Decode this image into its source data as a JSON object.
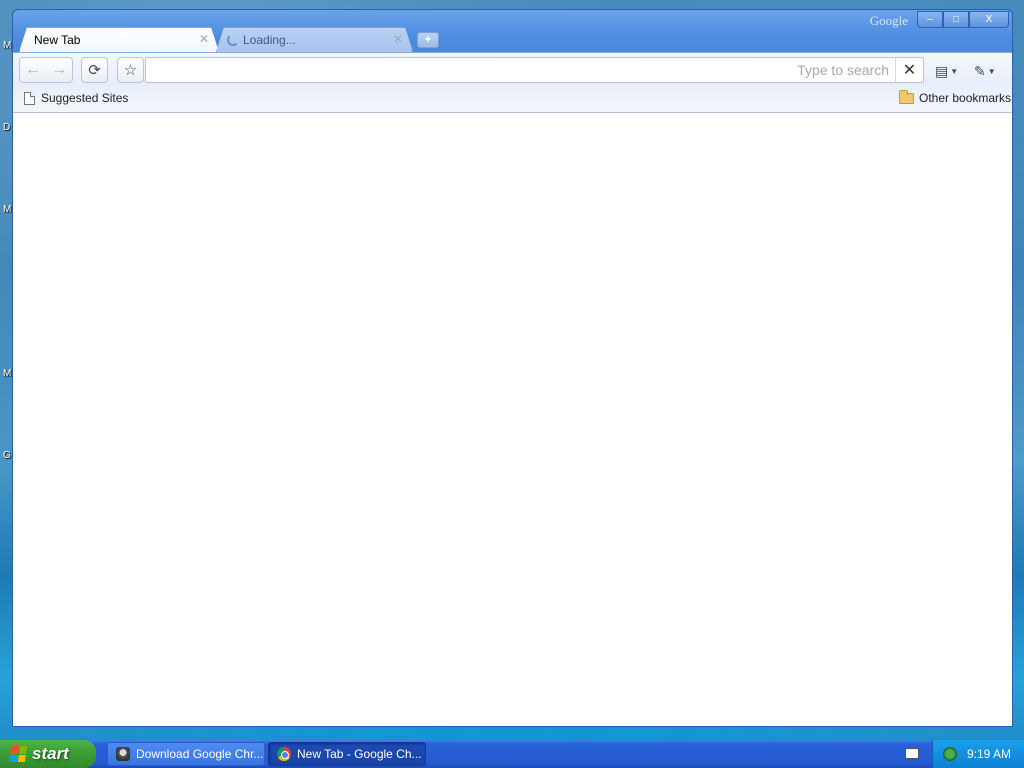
{
  "desktop": {
    "letters": [
      "M",
      "D",
      "M",
      "M",
      "G"
    ]
  },
  "window": {
    "brand_label": "Google",
    "controls": {
      "minimize": "–",
      "maximize": "□",
      "close": "X"
    }
  },
  "tabs": [
    {
      "title": "New Tab",
      "active": true
    },
    {
      "title": "Loading...",
      "active": false
    }
  ],
  "toolbar": {
    "back": "←",
    "forward": "→",
    "reload": "⟳",
    "star": "☆",
    "omnibox_placeholder": "Type to search",
    "clear": "✕",
    "page_menu": "▤",
    "wrench_menu": "✎"
  },
  "bookmarks": {
    "items": [
      {
        "label": "Suggested Sites"
      }
    ],
    "other_label": "Other bookmarks"
  },
  "taskbar": {
    "start_label": "start",
    "items": [
      {
        "label": "Download Google Chr..."
      },
      {
        "label": "New Tab - Google Ch..."
      }
    ],
    "clock": "9:19 AM"
  },
  "colors": {
    "titlebar": "#4f8de0",
    "start_button": "#3c9b37",
    "taskbar": "#245ad0",
    "tray": "#1290e0"
  }
}
